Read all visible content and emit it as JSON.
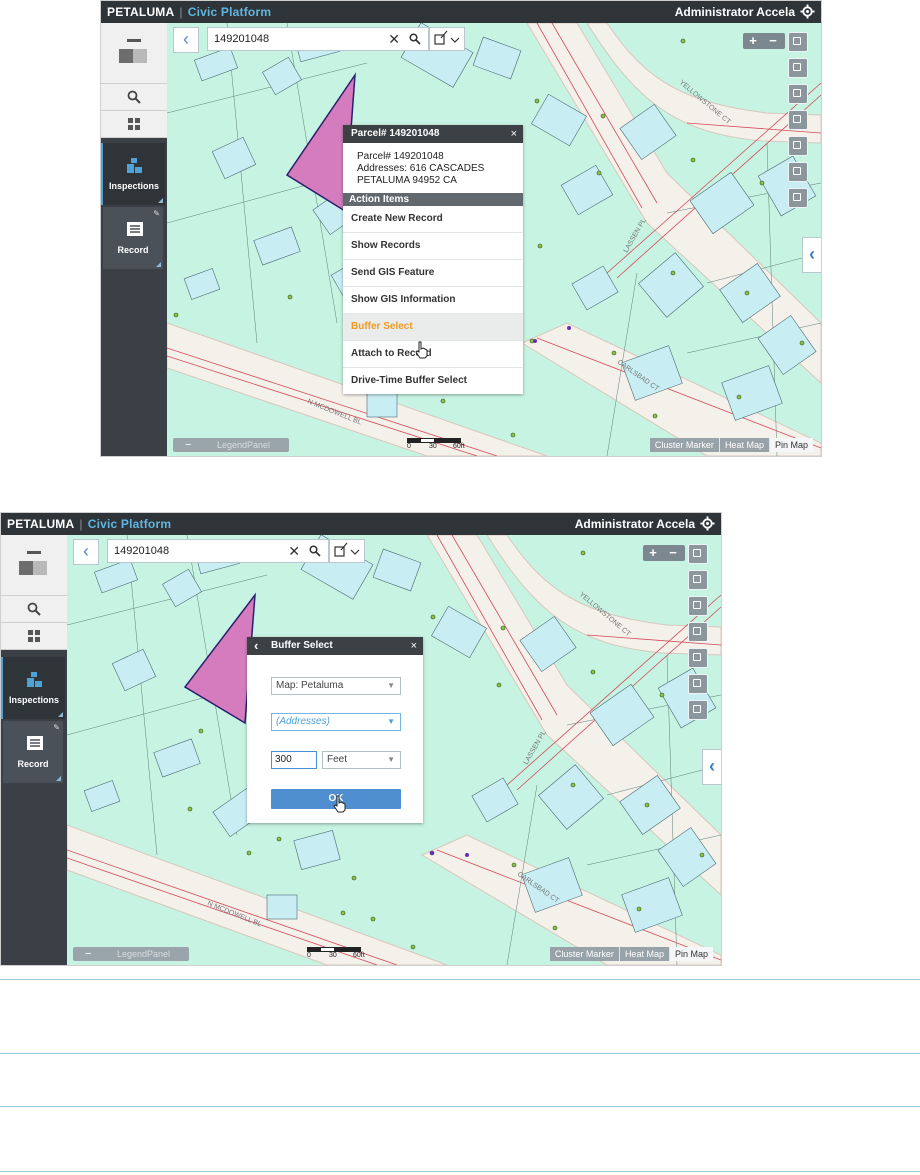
{
  "header": {
    "brand": "PETALUMA",
    "separator": "|",
    "product": "Civic Platform",
    "user": "Administrator Accela"
  },
  "sidebar": {
    "inspections_label": "Inspections",
    "record_label": "Record"
  },
  "search": {
    "value": "149201048"
  },
  "map": {
    "legend_label": "LegendPanel",
    "scale": {
      "zero": "0",
      "mid": "30",
      "end": "60ft"
    },
    "tabs": [
      "Cluster Marker",
      "Heat Map",
      "Pin Map"
    ],
    "selected_tab": "Pin Map",
    "street_labels": {
      "mcdowell": "N MCDOWELL BL",
      "carlsbad": "CARLSBAD CT",
      "lassen": "LASSEN PL",
      "yellowstone": "YELLOWSTONE CT"
    }
  },
  "parcel_popup": {
    "title": "Parcel# 149201048",
    "close": "×",
    "info_lines": [
      "Parcel# 149201048",
      "Addresses: 616 CASCADES",
      "PETALUMA 94952 CA"
    ],
    "section_title": "Action Items",
    "actions": [
      "Create New Record",
      "Show Records",
      "Send GIS Feature",
      "Show GIS Information",
      "Buffer Select",
      "Attach to Record",
      "Drive-Time Buffer Select"
    ],
    "highlighted_action": "Buffer Select"
  },
  "buffer_popup": {
    "title": "Buffer Select",
    "close": "×",
    "map_select": "Map: Petaluma",
    "layer_select": "(Addresses)",
    "distance": "300",
    "unit_select": "Feet",
    "ok_label": "OK"
  },
  "colors": {
    "topbar": "#2f3438",
    "accent": "#4da3d8",
    "map_land": "#c6f3e2",
    "parcel_highlight": "#d47cbd",
    "building": "#c8eef4",
    "road": "#f4f0ea",
    "highlight_action": "#f39a1e"
  }
}
